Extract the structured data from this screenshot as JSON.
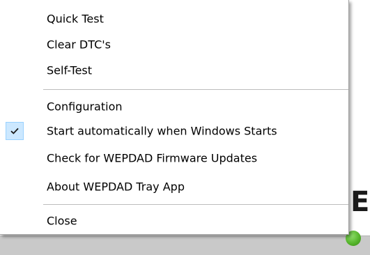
{
  "menu": {
    "items": [
      {
        "label": "Quick Test"
      },
      {
        "label": "Clear DTC's"
      },
      {
        "label": "Self-Test"
      },
      {
        "label": "Configuration"
      },
      {
        "label": "Start automatically when Windows Starts",
        "checked": true
      },
      {
        "label": "Check for WEPDAD Firmware Updates"
      },
      {
        "label": "About WEPDAD Tray App"
      },
      {
        "label": "Close"
      }
    ]
  },
  "background": {
    "partial_text": "E"
  },
  "colors": {
    "check_highlight": "#cce8ff",
    "check_border": "#99d1ff",
    "tray_icon": "#56b52c"
  },
  "icons": {
    "check": "checkmark-icon",
    "tray": "tray-status-icon"
  }
}
